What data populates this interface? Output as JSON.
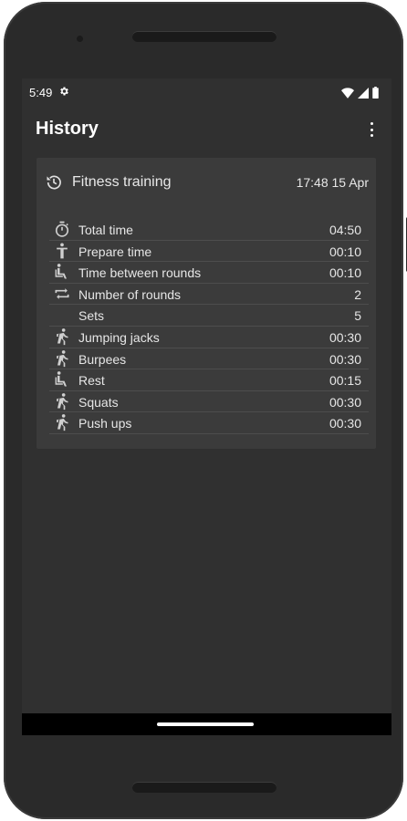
{
  "status_bar": {
    "time": "5:49",
    "gear_icon": "gear-icon",
    "wifi_icon": "wifi-icon",
    "signal_icon": "signal-icon",
    "battery_icon": "battery-icon"
  },
  "app_bar": {
    "title": "History",
    "overflow_icon": "more-vert-icon"
  },
  "card": {
    "icon": "history-icon",
    "title": "Fitness training",
    "datetime": "17:48 15 Apr",
    "rows": [
      {
        "icon": "stopwatch-icon",
        "label": "Total time",
        "value": "04:50"
      },
      {
        "icon": "person-standing-icon",
        "label": "Prepare time",
        "value": "00:10"
      },
      {
        "icon": "seated-person-icon",
        "label": "Time between rounds",
        "value": "00:10"
      },
      {
        "icon": "repeat-icon",
        "label": "Number of rounds",
        "value": "2"
      },
      {
        "icon": "",
        "label": "Sets",
        "value": "5"
      },
      {
        "icon": "running-person-icon",
        "label": "Jumping jacks",
        "value": "00:30"
      },
      {
        "icon": "running-person-icon",
        "label": "Burpees",
        "value": "00:30"
      },
      {
        "icon": "seated-person-icon",
        "label": "Rest",
        "value": "00:15"
      },
      {
        "icon": "running-person-icon",
        "label": "Squats",
        "value": "00:30"
      },
      {
        "icon": "running-person-icon",
        "label": "Push ups",
        "value": "00:30"
      }
    ]
  },
  "colors": {
    "background": "#303030",
    "card": "#3b3b3b",
    "text": "#e6e6e6",
    "divider": "#4d4d4d"
  }
}
